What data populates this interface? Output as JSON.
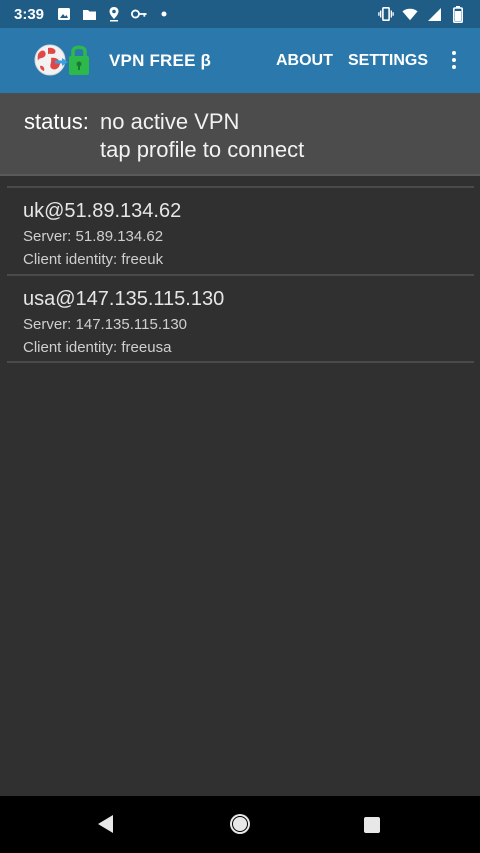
{
  "statusbar": {
    "time": "3:39",
    "left_icons": [
      "image-icon",
      "folder-icon",
      "pin-icon",
      "key-icon",
      "dot-icon"
    ],
    "right_icons": [
      "vibrate-icon",
      "wifi-icon",
      "signal-icon",
      "battery-icon"
    ]
  },
  "appbar": {
    "title": "VPN FREE β",
    "about_label": "ABOUT",
    "settings_label": "SETTINGS",
    "overflow_icon": "more-vert-icon",
    "logo_icon": "globe-lock-icon"
  },
  "status": {
    "label": "status:",
    "line1": "no active VPN",
    "line2": "tap profile to connect"
  },
  "profiles": [
    {
      "name": "uk@51.89.134.62",
      "server": "Server: 51.89.134.62",
      "identity": "Client identity: freeuk"
    },
    {
      "name": "usa@147.135.115.130",
      "server": "Server: 147.135.115.130",
      "identity": "Client identity: freeusa"
    }
  ],
  "navbar": {
    "back_icon": "back-triangle-icon",
    "home_icon": "home-circle-icon",
    "recents_icon": "recents-square-icon"
  },
  "colors": {
    "statusbar_bg": "#1f5d87",
    "appbar_bg": "#2a78ac",
    "status_panel_bg": "#4c4c4c",
    "background": "#303030",
    "navbar_bg": "#000000"
  }
}
